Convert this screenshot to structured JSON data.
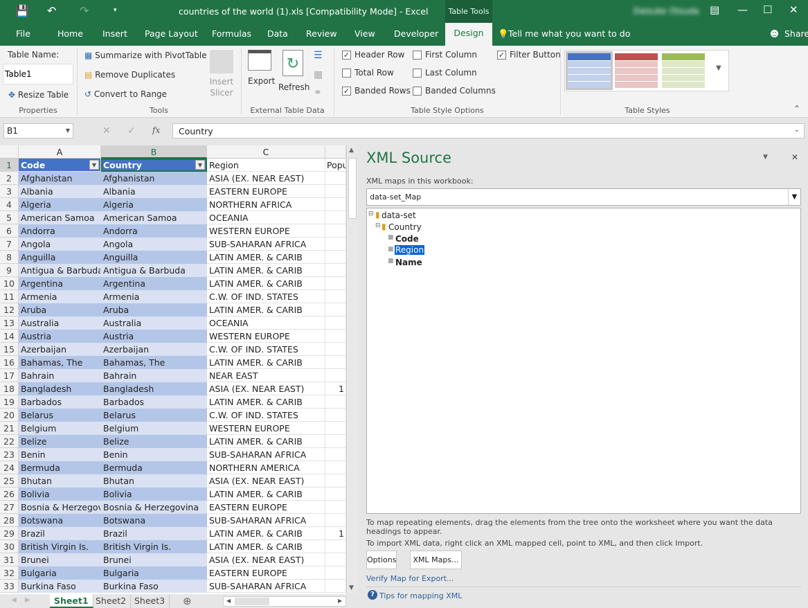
{
  "window": {
    "title": "countries of the world (1).xls  [Compatibility Mode]  -  Excel",
    "context_tab": "Table Tools",
    "user": "Daisuke Otsuda"
  },
  "menu_tabs": [
    "File",
    "Home",
    "Insert",
    "Page Layout",
    "Formulas",
    "Data",
    "Review",
    "View",
    "Developer",
    "Design"
  ],
  "active_tab": "Design",
  "tell_me": "Tell me what you want to do",
  "share": "Share",
  "ribbon": {
    "properties": {
      "label": "Table Name:",
      "table_name": "Table1",
      "resize": "Resize Table",
      "group": "Properties"
    },
    "tools": {
      "pivot": "Summarize with PivotTable",
      "dupes": "Remove Duplicates",
      "convert": "Convert to Range",
      "slicer": "Insert Slicer",
      "group": "Tools"
    },
    "external": {
      "export": "Export",
      "refresh": "Refresh",
      "group": "External Table Data"
    },
    "style_options": {
      "group": "Table Style Options",
      "options": [
        {
          "label": "Header Row",
          "checked": true
        },
        {
          "label": "Total Row",
          "checked": false
        },
        {
          "label": "Banded Rows",
          "checked": true
        },
        {
          "label": "First Column",
          "checked": false
        },
        {
          "label": "Last Column",
          "checked": false
        },
        {
          "label": "Banded Columns",
          "checked": false
        },
        {
          "label": "Filter Button",
          "checked": true
        }
      ]
    },
    "table_styles": {
      "group": "Table Styles",
      "colors": [
        "#4472c4",
        "#c0504d",
        "#9bbb59"
      ]
    }
  },
  "formula_bar": {
    "name_box": "B1",
    "fx": "fx",
    "value": "Country"
  },
  "columns": [
    "A",
    "B",
    "C"
  ],
  "header": [
    "Code",
    "Country",
    "Region",
    "Popu"
  ],
  "rows": [
    [
      "Afghanistan",
      "Afghanistan",
      "ASIA (EX. NEAR EAST)",
      ""
    ],
    [
      "Albania",
      "Albania",
      "EASTERN EUROPE",
      ""
    ],
    [
      "Algeria",
      "Algeria",
      "NORTHERN AFRICA",
      ""
    ],
    [
      "American Samoa",
      "American Samoa",
      "OCEANIA",
      ""
    ],
    [
      "Andorra",
      "Andorra",
      "WESTERN EUROPE",
      ""
    ],
    [
      "Angola",
      "Angola",
      "SUB-SAHARAN AFRICA",
      ""
    ],
    [
      "Anguilla",
      "Anguilla",
      "LATIN AMER. & CARIB",
      ""
    ],
    [
      "Antigua & Barbuda",
      "Antigua & Barbuda",
      "LATIN AMER. & CARIB",
      ""
    ],
    [
      "Argentina",
      "Argentina",
      "LATIN AMER. & CARIB",
      ""
    ],
    [
      "Armenia",
      "Armenia",
      "C.W. OF IND. STATES",
      ""
    ],
    [
      "Aruba",
      "Aruba",
      "LATIN AMER. & CARIB",
      ""
    ],
    [
      "Australia",
      "Australia",
      "OCEANIA",
      ""
    ],
    [
      "Austria",
      "Austria",
      "WESTERN EUROPE",
      ""
    ],
    [
      "Azerbaijan",
      "Azerbaijan",
      "C.W. OF IND. STATES",
      ""
    ],
    [
      "Bahamas, The",
      "Bahamas, The",
      "LATIN AMER. & CARIB",
      ""
    ],
    [
      "Bahrain",
      "Bahrain",
      "NEAR EAST",
      ""
    ],
    [
      "Bangladesh",
      "Bangladesh",
      "ASIA (EX. NEAR EAST)",
      "1"
    ],
    [
      "Barbados",
      "Barbados",
      "LATIN AMER. & CARIB",
      ""
    ],
    [
      "Belarus",
      "Belarus",
      "C.W. OF IND. STATES",
      ""
    ],
    [
      "Belgium",
      "Belgium",
      "WESTERN EUROPE",
      ""
    ],
    [
      "Belize",
      "Belize",
      "LATIN AMER. & CARIB",
      ""
    ],
    [
      "Benin",
      "Benin",
      "SUB-SAHARAN AFRICA",
      ""
    ],
    [
      "Bermuda",
      "Bermuda",
      "NORTHERN AMERICA",
      ""
    ],
    [
      "Bhutan",
      "Bhutan",
      "ASIA (EX. NEAR EAST)",
      ""
    ],
    [
      "Bolivia",
      "Bolivia",
      "LATIN AMER. & CARIB",
      ""
    ],
    [
      "Bosnia & Herzegovina",
      "Bosnia & Herzegovina",
      "EASTERN EUROPE",
      ""
    ],
    [
      "Botswana",
      "Botswana",
      "SUB-SAHARAN AFRICA",
      ""
    ],
    [
      "Brazil",
      "Brazil",
      "LATIN AMER. & CARIB",
      "1"
    ],
    [
      "British Virgin Is.",
      "British Virgin Is.",
      "LATIN AMER. & CARIB",
      ""
    ],
    [
      "Brunei",
      "Brunei",
      "ASIA (EX. NEAR EAST)",
      ""
    ],
    [
      "Bulgaria",
      "Bulgaria",
      "EASTERN EUROPE",
      ""
    ],
    [
      "Burkina Faso",
      "Burkina Faso",
      "SUB-SAHARAN AFRICA",
      ""
    ]
  ],
  "sheets": [
    "Sheet1",
    "Sheet2",
    "Sheet3"
  ],
  "active_sheet": "Sheet1",
  "xml_panel": {
    "title": "XML Source",
    "maps_label": "XML maps in this workbook:",
    "map": "data-set_Map",
    "tree": {
      "root": "data-set",
      "child": "Country",
      "leaves": [
        "Code",
        "Region",
        "Name"
      ],
      "selected": "Region"
    },
    "hint1": "To map repeating elements, drag the elements from the tree onto the worksheet where you want the data headings to appear.",
    "hint2": "To import XML data, right click an XML mapped cell, point to XML, and then click Import.",
    "options": "Options",
    "xml_maps": "XML Maps...",
    "verify": "Verify Map for Export...",
    "tips": "Tips for mapping XML"
  },
  "accent": "#217346"
}
